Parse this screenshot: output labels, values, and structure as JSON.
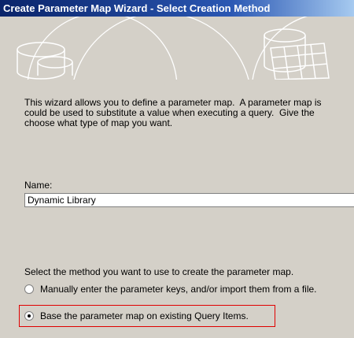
{
  "window": {
    "title": "Create Parameter Map Wizard - Select Creation Method"
  },
  "intro": {
    "line1": "This wizard allows you to define a parameter map.  A parameter map is",
    "line2": "could be used to substitute a value when executing a query.  Give the",
    "line3": "choose what type of map you want."
  },
  "name": {
    "label": "Name:",
    "value": "Dynamic Library"
  },
  "method": {
    "label": "Select the method you want to use to create the parameter map.",
    "options": [
      {
        "label": "Manually enter the parameter keys, and/or import them from a file.",
        "selected": false
      },
      {
        "label": "Base the parameter map on existing Query Items.",
        "selected": true
      }
    ]
  },
  "colors": {
    "titlebar": "#0a246a",
    "face": "#d4d0c8",
    "highlight": "#e00000"
  }
}
